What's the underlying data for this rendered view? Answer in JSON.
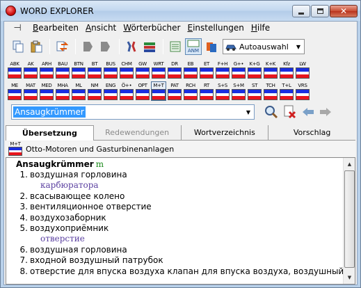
{
  "window": {
    "title": "WORD EXPLORER"
  },
  "menu": [
    "Bearbeiten",
    "Ansicht",
    "Wörterbücher",
    "Einstellungen",
    "Hilfe"
  ],
  "toolbar": {
    "icons": [
      "copy-icon",
      "paste-icon",
      "swap-icon",
      "back-page-icon",
      "forward-page-icon",
      "tools-icon",
      "books-icon",
      "list-view-icon",
      "anm-icon",
      "dictionary-switch-icon",
      "car-icon"
    ],
    "anm_label": "ANM",
    "auto_select": "Autoauswahl"
  },
  "dictionaries_row1": [
    "ABK",
    "AK",
    "ARH",
    "BAU",
    "BTN",
    "BT",
    "BUS",
    "CHM",
    "GW",
    "WRT",
    "DR",
    "EB",
    "ET",
    "F+H",
    "G+•",
    "K+G",
    "K+K",
    "Kfz",
    "LW"
  ],
  "dictionaries_row2": [
    "ME",
    "MAT",
    "MED",
    "MHA",
    "ML",
    "NM",
    "ENG",
    "Ö+•",
    "OPT",
    "M+T",
    "PAT",
    "RCH",
    "RT",
    "S+S",
    "S+M",
    "ST",
    "TCH",
    "T+L",
    "VRS"
  ],
  "active_dictionary": "M+T",
  "search": {
    "value": "Ansaugkrümmer"
  },
  "tabs": [
    {
      "label": "Übersetzung",
      "state": "active"
    },
    {
      "label": "Redewendungen",
      "state": "disabled"
    },
    {
      "label": "Wortverzeichnis",
      "state": "normal"
    },
    {
      "label": "Vorschlag",
      "state": "normal"
    }
  ],
  "dict_info": {
    "code": "M+T",
    "name": "Otto-Motoren und Gasturbinenanlagen"
  },
  "entry": {
    "headword": "Ansaugkrümmer",
    "gender": "m",
    "senses": [
      {
        "num": "1.",
        "text": "воздушная горловина",
        "gloss": "карбюратора"
      },
      {
        "num": "2.",
        "text": "всасывающее колено"
      },
      {
        "num": "3.",
        "text": "вентиляционное отверстие"
      },
      {
        "num": "4.",
        "text": "воздухозаборник"
      },
      {
        "num": "5.",
        "text": "воздухоприёмник",
        "gloss": "отверстие"
      },
      {
        "num": "6.",
        "text": "воздушная горловина"
      },
      {
        "num": "7.",
        "text": "входной воздушный патрубок"
      },
      {
        "num": "8.",
        "text": "отверстие для впуска воздуха клапан для впуска воздуха, воздушный"
      }
    ]
  },
  "colors": {
    "flag_blue": "#1a2ee0",
    "flag_red": "#e8161e",
    "selection": "#3399ff",
    "gloss": "#5a3fa0",
    "gender": "#1a8a1a"
  }
}
